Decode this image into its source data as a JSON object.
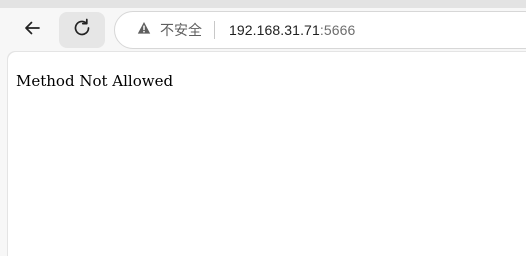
{
  "toolbar": {
    "back_icon": "back-arrow-icon",
    "reload_icon": "reload-icon"
  },
  "address_bar": {
    "security_icon": "warning-triangle-icon",
    "security_label": "不安全",
    "url_host": "192.168.31.71",
    "url_port": ":5666"
  },
  "page": {
    "message": "Method Not Allowed"
  }
}
